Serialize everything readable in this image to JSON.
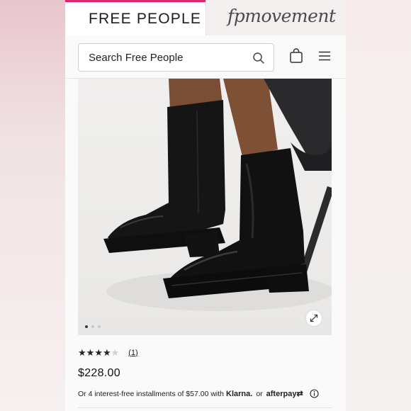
{
  "header": {
    "brand_tab": "FREE PEOPLE",
    "movement_tab": "fpmovement"
  },
  "search": {
    "placeholder": "Search Free People",
    "icon": "search-icon"
  },
  "icons": {
    "bag": "shopping-bag-icon",
    "menu": "hamburger-menu-icon",
    "expand": "expand-arrows-icon",
    "info": "info-circle-icon"
  },
  "gallery": {
    "image_count": 3,
    "active_index": 0
  },
  "product": {
    "rating": 4,
    "rating_max": 5,
    "review_count": "(1)",
    "price": "$228.00",
    "installments_text": "Or 4 interest-free installments of $57.00 with",
    "klarna": "Klarna.",
    "or": "or",
    "afterpay": "afterpay⇄"
  },
  "colors": {
    "accent": "#e0256f",
    "text": "#1d1d1d"
  }
}
